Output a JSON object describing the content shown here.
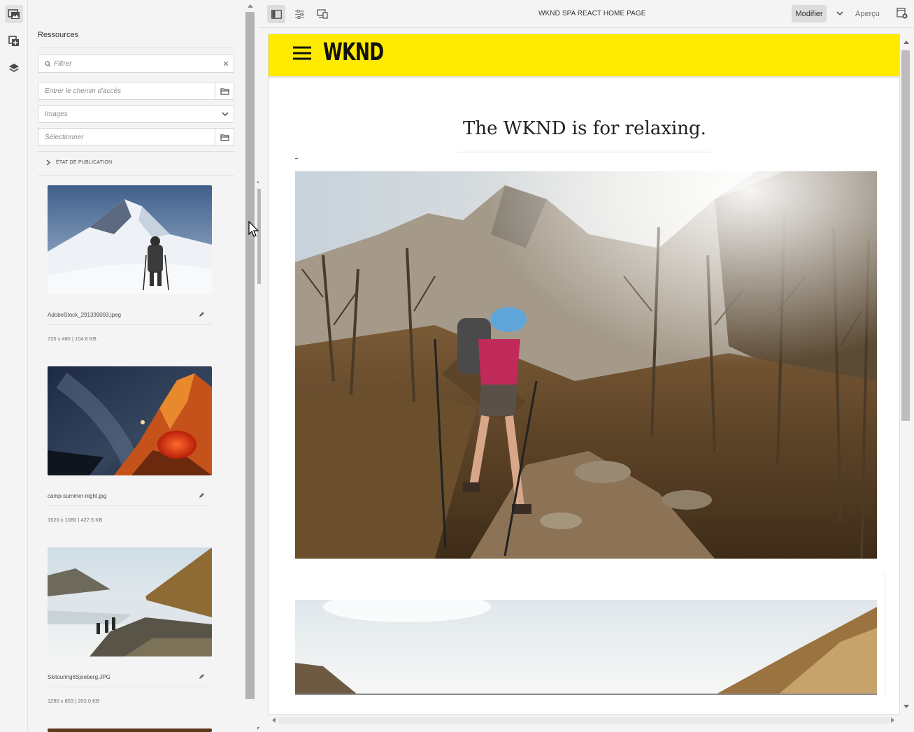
{
  "rail": {
    "items": [
      {
        "icon": "assets-icon",
        "active": true
      },
      {
        "icon": "components-icon",
        "active": false
      },
      {
        "icon": "content-tree-icon",
        "active": false
      }
    ]
  },
  "panel": {
    "title": "Ressources",
    "filter_placeholder": "Filtrer",
    "path_placeholder": "Entrer le chemin d'accès",
    "type_value": "Images",
    "tags_placeholder": "Sélectionner",
    "publication_label": "ÉTAT DE PUBLICATION"
  },
  "assets": [
    {
      "name": "AdobeStock_291339093.jpeg",
      "meta": "720 x 480 | 104.6 KB"
    },
    {
      "name": "camp-summer-night.jpg",
      "meta": "1620 x 1080 | 427.5 KB"
    },
    {
      "name": "Skitouring6Sjoeberg.JPG",
      "meta": "1280 x 853 | 203.0 KB"
    }
  ],
  "toolbar": {
    "page_title": "WKND SPA REACT HOME PAGE",
    "mode_label": "Modifier",
    "preview_label": "Aperçu"
  },
  "site": {
    "logo": "WKND",
    "headline": "The WKND is for relaxing."
  },
  "colors": {
    "brand_yellow": "#ffea00",
    "panel_bg": "#f4f4f4"
  }
}
